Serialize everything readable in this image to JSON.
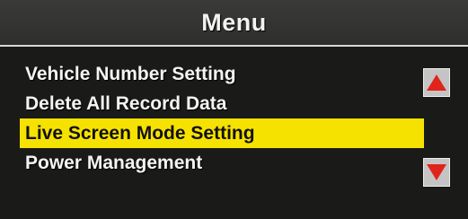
{
  "header": {
    "title": "Menu"
  },
  "menu": {
    "items": [
      {
        "label": "Vehicle Number Setting"
      },
      {
        "label": "Delete All Record Data"
      },
      {
        "label": "Live Screen Mode Setting"
      },
      {
        "label": "Power Management"
      }
    ],
    "selected_index": 2
  },
  "scroll": {
    "up_icon": "triangle-up-icon",
    "down_icon": "triangle-down-icon"
  },
  "colors": {
    "background": "#161614",
    "title_bar": "#2e2e2c",
    "selection_highlight": "#f6e200",
    "arrow_red": "#e0241c",
    "text": "#f4f4f4"
  }
}
